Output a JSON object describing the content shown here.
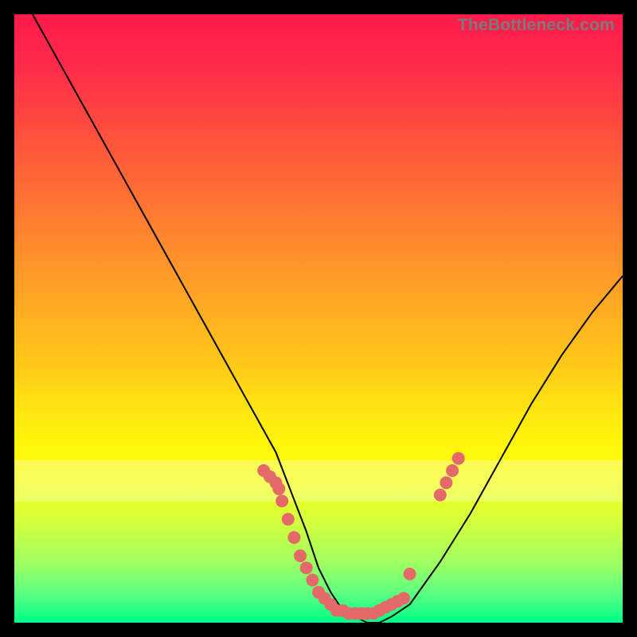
{
  "watermark": "TheBottleneck.com",
  "colors": {
    "dot": "#e46a6a",
    "curve": "#000000",
    "frame": "#000000"
  },
  "chart_data": {
    "type": "line",
    "title": "",
    "xlabel": "",
    "ylabel": "",
    "xlim": [
      0,
      100
    ],
    "ylim": [
      0,
      100
    ],
    "grid": false,
    "series": [
      {
        "name": "bottleneck-curve",
        "x": [
          3,
          8,
          13,
          18,
          23,
          28,
          33,
          38,
          43,
          48,
          50,
          52,
          54,
          56,
          58,
          60,
          62,
          65,
          70,
          75,
          80,
          85,
          90,
          95,
          100
        ],
        "values": [
          100,
          91,
          82,
          73,
          64,
          55,
          46,
          37,
          28,
          15,
          9,
          5,
          2,
          1,
          0,
          0,
          1,
          3,
          10,
          18,
          27,
          36,
          44,
          51,
          57
        ]
      }
    ],
    "highlight_band_y": [
      22,
      28
    ],
    "dots": [
      {
        "x": 41,
        "y": 25
      },
      {
        "x": 42,
        "y": 24
      },
      {
        "x": 43,
        "y": 23
      },
      {
        "x": 43.5,
        "y": 22
      },
      {
        "x": 44,
        "y": 20
      },
      {
        "x": 45,
        "y": 17
      },
      {
        "x": 46,
        "y": 14
      },
      {
        "x": 47,
        "y": 11
      },
      {
        "x": 48,
        "y": 9
      },
      {
        "x": 49,
        "y": 7
      },
      {
        "x": 50,
        "y": 5
      },
      {
        "x": 51,
        "y": 4
      },
      {
        "x": 52,
        "y": 3
      },
      {
        "x": 53,
        "y": 2
      },
      {
        "x": 54,
        "y": 2
      },
      {
        "x": 55,
        "y": 1.5
      },
      {
        "x": 56,
        "y": 1.5
      },
      {
        "x": 57,
        "y": 1.5
      },
      {
        "x": 58,
        "y": 1.5
      },
      {
        "x": 59,
        "y": 1.5
      },
      {
        "x": 60,
        "y": 2
      },
      {
        "x": 61,
        "y": 2.5
      },
      {
        "x": 62,
        "y": 3
      },
      {
        "x": 63,
        "y": 3.5
      },
      {
        "x": 64,
        "y": 4
      },
      {
        "x": 65,
        "y": 8
      },
      {
        "x": 70,
        "y": 21
      },
      {
        "x": 71,
        "y": 23
      },
      {
        "x": 72,
        "y": 25
      },
      {
        "x": 73,
        "y": 27
      }
    ]
  }
}
